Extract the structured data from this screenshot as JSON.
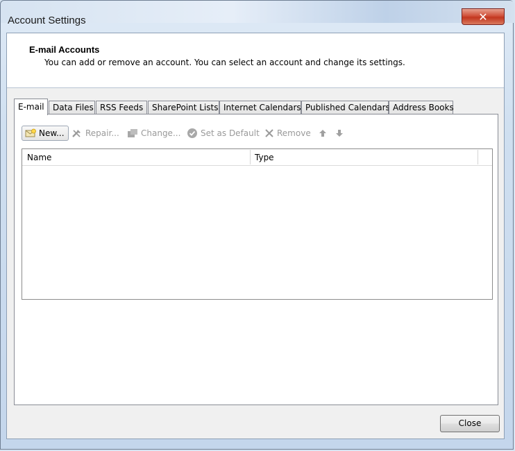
{
  "window": {
    "title": "Account Settings",
    "close_glyph": "✕"
  },
  "header": {
    "title": "E-mail Accounts",
    "description": "You can add or remove an account. You can select an account and change its settings."
  },
  "tabs": [
    {
      "label": "E-mail",
      "active": true
    },
    {
      "label": "Data Files"
    },
    {
      "label": "RSS Feeds"
    },
    {
      "label": "SharePoint Lists"
    },
    {
      "label": "Internet Calendars"
    },
    {
      "label": "Published Calendars"
    },
    {
      "label": "Address Books"
    }
  ],
  "toolbar": {
    "new_label": "New...",
    "repair_label": "Repair...",
    "change_label": "Change...",
    "default_label": "Set as Default",
    "remove_label": "Remove",
    "icons": [
      "new-account-icon",
      "repair-tools-icon",
      "change-icon",
      "checkmark-icon",
      "remove-x-icon",
      "move-up-arrow-icon",
      "move-down-arrow-icon"
    ]
  },
  "list": {
    "columns": [
      "Name",
      "Type"
    ],
    "rows": []
  },
  "footer": {
    "close_label": "Close"
  },
  "colors": {
    "close_button_red": "#c2361f",
    "disabled_text": "#9a9a9a"
  }
}
